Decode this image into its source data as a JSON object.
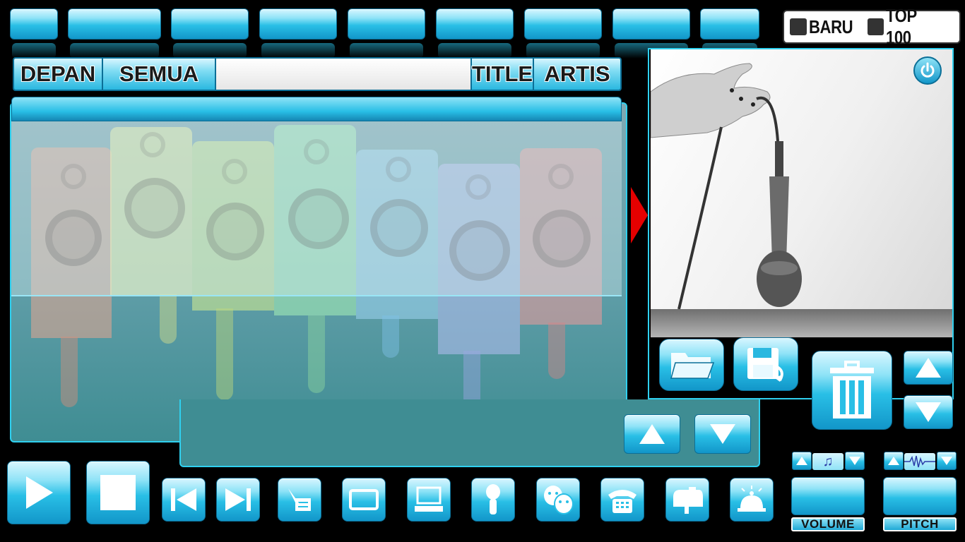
{
  "top_tabs": [
    "",
    "",
    "",
    "",
    "",
    "",
    "",
    "",
    ""
  ],
  "toggles": [
    {
      "label": "BARU",
      "checked": true
    },
    {
      "label": "TOP 100",
      "checked": true
    }
  ],
  "search": {
    "tab_depan": "DEPAN",
    "tab_semua": "SEMUA",
    "tab_title": "TITLE",
    "tab_artis": "ARTIS",
    "value": "",
    "placeholder": ""
  },
  "sliders": {
    "volume_label": "VOLUME",
    "pitch_label": "PITCH"
  },
  "colors": {
    "accent": "#29bfe6",
    "border": "#2fd0ef",
    "indicator": "#e60000"
  },
  "icons": {
    "power": "power-icon",
    "folder": "folder-open-icon",
    "save": "save-icon",
    "trash": "trash-icon",
    "play": "play-icon",
    "stop": "stop-icon",
    "prev": "skip-previous-icon",
    "next": "skip-next-icon",
    "lyrics": "document-pen-icon",
    "screen": "screen-icon",
    "computer": "computer-icon",
    "mic": "microphone-icon",
    "theater": "theater-masks-icon",
    "phone": "telephone-icon",
    "mailbox": "mailbox-icon",
    "bell": "service-bell-icon"
  }
}
